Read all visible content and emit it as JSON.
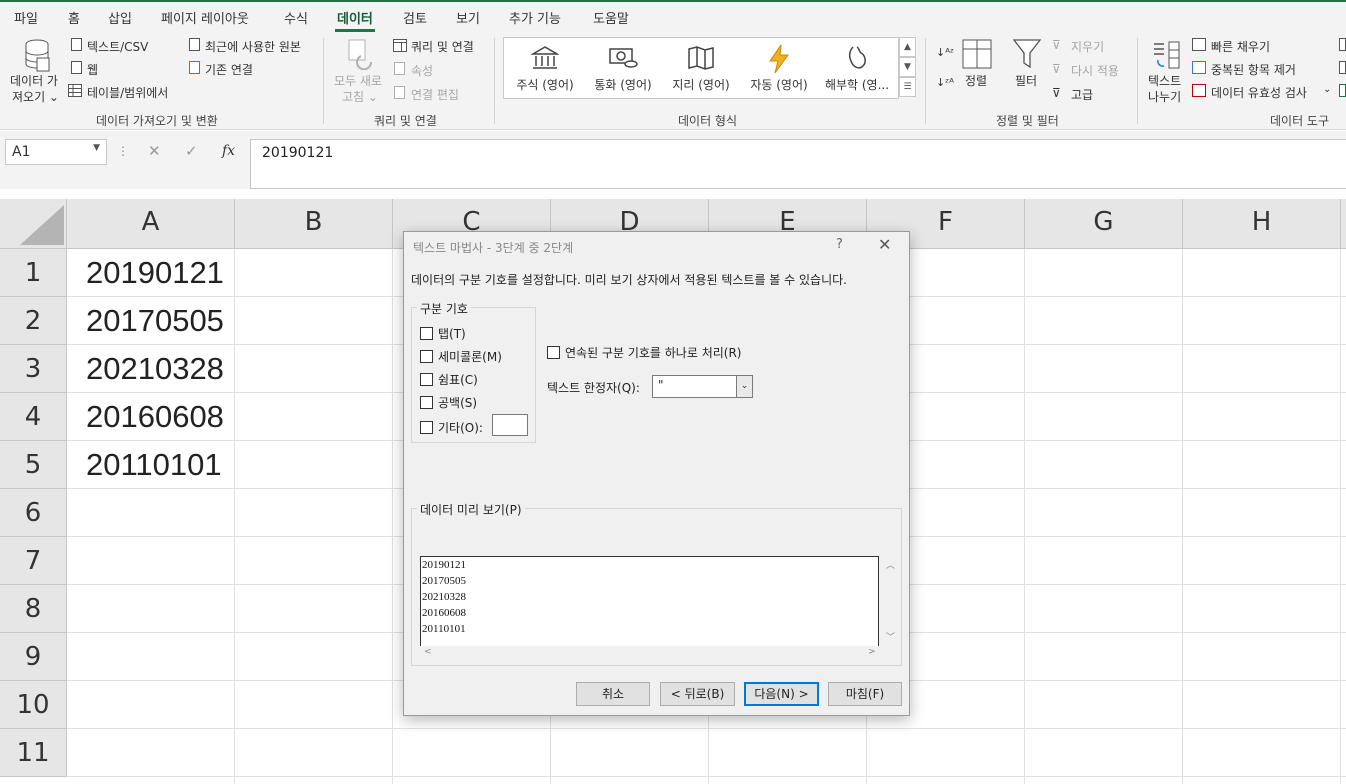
{
  "menu": {
    "tabs": [
      "파일",
      "홈",
      "삽입",
      "페이지 레이아웃",
      "수식",
      "데이터",
      "검토",
      "보기",
      "추가 기능",
      "도움말"
    ],
    "active": "데이터"
  },
  "ribbon": {
    "get_data": {
      "big_button": [
        "데이터 가",
        "져오기 ⌄"
      ],
      "text_csv": "텍스트/CSV",
      "web": "웹",
      "from_table": "테이블/범위에서",
      "recent_sources": "최근에 사용한 원본",
      "existing_conn": "기존 연결",
      "label": "데이터 가져오기 및 변환"
    },
    "queries": {
      "refresh_all": [
        "모두 새로",
        "고침 ⌄"
      ],
      "queries_conn": "쿼리 및 연결",
      "properties": "속성",
      "edit_links": "연결 편집",
      "label": "쿼리 및 연결"
    },
    "data_types": {
      "items": [
        "주식 (영어)",
        "통화 (영어)",
        "지리 (영어)",
        "자동 (영어)",
        "해부학 (영..."
      ],
      "label": "데이터 형식"
    },
    "sort_filter": {
      "sort": "정렬",
      "filter": "필터",
      "clear": "지우기",
      "reapply": "다시 적용",
      "advanced": "고급",
      "label": "정렬 및 필터"
    },
    "data_tools": {
      "text_to_cols": [
        "텍스트",
        "나누기"
      ],
      "flash_fill": "빠른 채우기",
      "remove_dupes": "중복된 항목 제거",
      "validation": "데이터 유효성 검사",
      "label": "데이터 도구"
    }
  },
  "formula_bar": {
    "name_box": "A1",
    "fx": "fx",
    "value": "20190121"
  },
  "sheet": {
    "columns": [
      "A",
      "B",
      "C",
      "D",
      "E",
      "F",
      "G",
      "H"
    ],
    "rows": [
      "1",
      "2",
      "3",
      "4",
      "5",
      "6",
      "7",
      "8",
      "9",
      "10",
      "11"
    ],
    "column_a": [
      "20190121",
      "20170505",
      "20210328",
      "20160608",
      "20110101"
    ]
  },
  "dialog": {
    "title": "텍스트 마법사 - 3단계 중 2단계",
    "help": "?",
    "description": "데이터의 구분 기호를 설정합니다. 미리 보기 상자에서 적용된 텍스트를 볼 수 있습니다.",
    "delimiters_label": "구분 기호",
    "delimiters": [
      {
        "label": "탭(T)",
        "checked": false
      },
      {
        "label": "세미콜론(M)",
        "checked": false
      },
      {
        "label": "쉼표(C)",
        "checked": false
      },
      {
        "label": "공백(S)",
        "checked": false
      },
      {
        "label": "기타(O):",
        "checked": false
      }
    ],
    "consecutive": "연속된 구분 기호를 하나로 처리(R)",
    "qualifier_label": "텍스트 한정자(Q):",
    "qualifier_value": "\"",
    "preview_label": "데이터 미리 보기(P)",
    "preview_lines": [
      "20190121",
      "20170505",
      "20210328",
      "20160608",
      "20110101"
    ],
    "buttons": {
      "cancel": "취소",
      "back": "< 뒤로(B)",
      "next": "다음(N) >",
      "finish": "마침(F)"
    }
  }
}
